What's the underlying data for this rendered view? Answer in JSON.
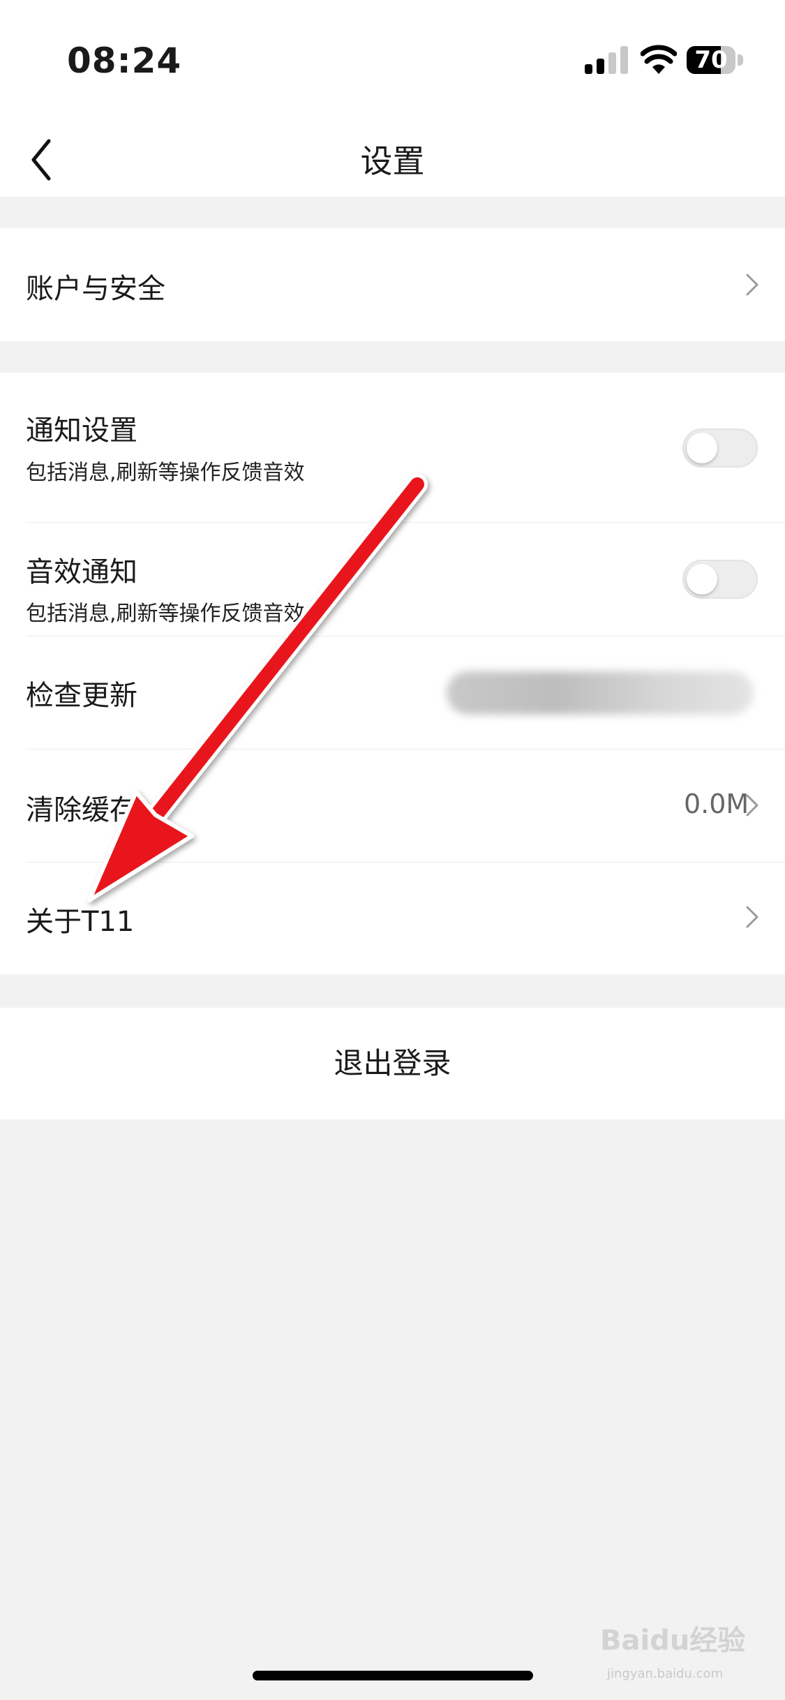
{
  "status_bar": {
    "time": "08:24",
    "battery_level": "70",
    "battery_fraction": 0.7
  },
  "nav": {
    "title": "设置"
  },
  "settings": {
    "account_security": "账户与安全",
    "notification_settings": {
      "label": "通知设置",
      "subtitle": "包括消息,刷新等操作反馈音效",
      "enabled": false
    },
    "sound_notification": {
      "label": "音效通知",
      "subtitle": "包括消息,刷新等操作反馈音效",
      "enabled": false
    },
    "check_update": {
      "label": "检查更新"
    },
    "clear_cache": {
      "label": "清除缓存",
      "value": "0.0M"
    },
    "about": "关于T11"
  },
  "logout": {
    "label": "退出登录"
  },
  "watermark": {
    "brand": "Baidu经验",
    "url": "jingyan.baidu.com"
  },
  "colors": {
    "annotation_arrow": "#e8141b",
    "background": "#f2f2f2",
    "card": "#ffffff"
  },
  "icons": {
    "back": "chevron-left-icon",
    "chevron": "chevron-right-icon"
  }
}
